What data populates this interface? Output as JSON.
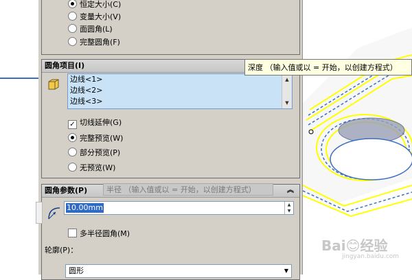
{
  "fillet_type_options": [
    {
      "label": "恒定大小(C)",
      "selected": true
    },
    {
      "label": "变量大小(V)",
      "selected": false
    },
    {
      "label": "面圆角(L)",
      "selected": false
    },
    {
      "label": "完整圆角(F)",
      "selected": false
    }
  ],
  "fillet_items": {
    "header": "圆角项目(I)",
    "edges": [
      "边线<1>",
      "边线<2>",
      "边线<3>"
    ],
    "tangent_propagation": {
      "label": "切线延伸(G)",
      "checked": true
    },
    "preview_options": [
      {
        "label": "完整预览(W)",
        "selected": true
      },
      {
        "label": "部分预览(P)",
        "selected": false
      },
      {
        "label": "无预览(W)",
        "selected": false
      }
    ]
  },
  "fillet_params": {
    "header": "圆角参数(P)",
    "radius_value": "10.00mm",
    "multi_radius": {
      "label": "多半径圆角(M)",
      "checked": false
    },
    "profile_label": "轮廓(P)：",
    "profile_value": "圆形"
  },
  "tooltips": {
    "depth_tooltip": "深度 （输入值或以 = 开始，以创建方程式）",
    "radius_tooltip": "半径 （输入值或以 = 开始，以创建方程式）"
  },
  "watermark": {
    "main": "Bai😊经验",
    "sub": "jingyan.baidu.com"
  },
  "colors": {
    "panel_bg": "#d4d0c8",
    "list_selection": "#c9e2f6",
    "model_yellow": "#ffff00",
    "model_blue": "#3a6fc4"
  }
}
